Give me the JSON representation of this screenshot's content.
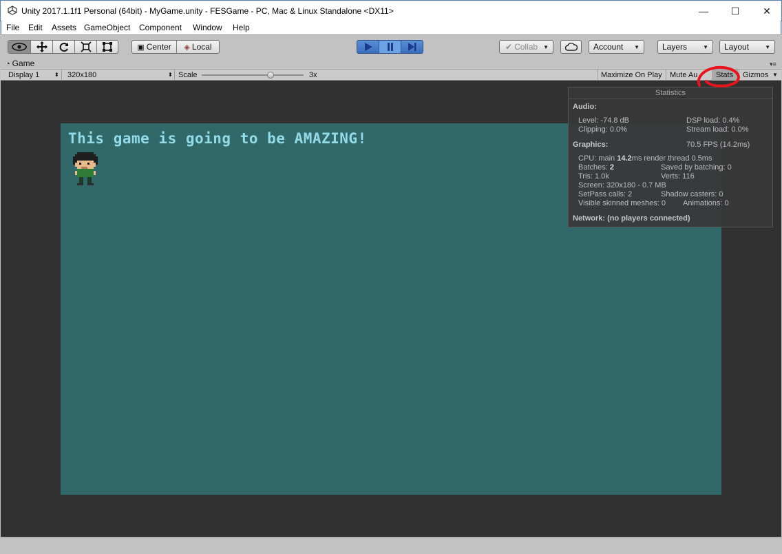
{
  "window": {
    "title": "Unity 2017.1.1f1 Personal (64bit) - MyGame.unity - FESGame - PC, Mac & Linux Standalone <DX11>",
    "minimize": "—",
    "maximize": "☐",
    "close": "✕"
  },
  "menu": [
    "File",
    "Edit",
    "Assets",
    "GameObject",
    "Component",
    "Window",
    "Help"
  ],
  "toolbar": {
    "pivot": "Center",
    "handle": "Local",
    "collab": "Collab",
    "account": "Account",
    "layers": "Layers",
    "layout": "Layout"
  },
  "game_tab": {
    "label": "Game",
    "display": "Display 1",
    "resolution": "320x180",
    "scale_label": "Scale",
    "scale_value": "3x",
    "maximize_on_play": "Maximize On Play",
    "mute_audio": "Mute Au",
    "stats": "Stats",
    "gizmos": "Gizmos"
  },
  "game": {
    "message": "This game is going to be AMAZING!"
  },
  "statistics": {
    "title": "Statistics",
    "audio_header": "Audio:",
    "level": "Level: -74.8 dB",
    "dsp_load": "DSP load: 0.4%",
    "clipping": "Clipping: 0.0%",
    "stream_load": "Stream load: 0.0%",
    "graphics_header": "Graphics:",
    "fps": "70.5 FPS (14.2ms)",
    "cpu_prefix": "CPU: main ",
    "cpu_main": "14.2",
    "cpu_suffix": "ms  render thread 0.5ms",
    "batches_prefix": "Batches: ",
    "batches": "2",
    "saved_batching": "Saved by batching: 0",
    "tris": "Tris: 1.0k",
    "verts": "Verts: 116",
    "screen": "Screen: 320x180 - 0.7 MB",
    "setpass": "SetPass calls: 2",
    "shadow_casters": "Shadow casters: 0",
    "skinned": "Visible skinned meshes: 0",
    "animations": "Animations: 0",
    "network": "Network: (no players connected)"
  },
  "colors": {
    "viewport": "#31696b",
    "game_text": "#94dbe8",
    "annotation": "#e8141c"
  }
}
